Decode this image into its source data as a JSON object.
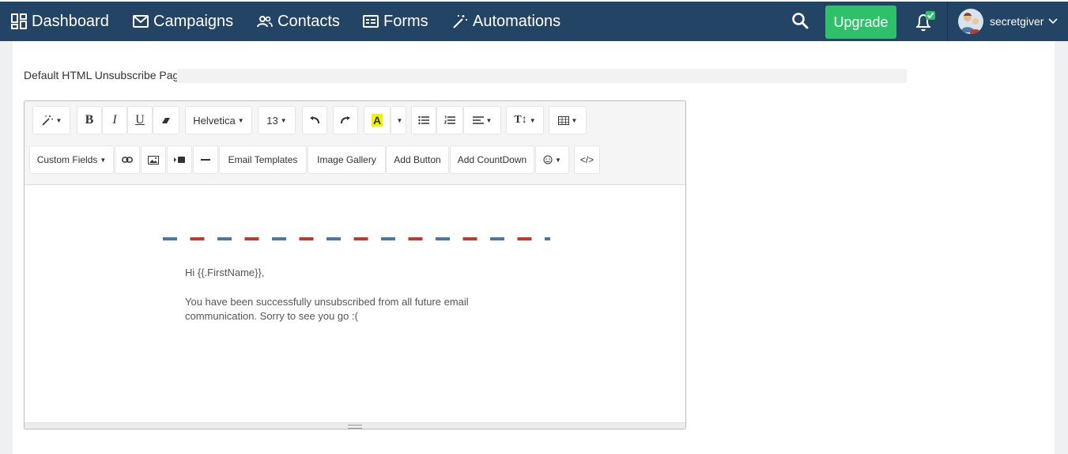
{
  "nav": {
    "items": [
      {
        "label": "Dashboard",
        "icon": "dashboard-icon"
      },
      {
        "label": "Campaigns",
        "icon": "envelope-icon"
      },
      {
        "label": "Contacts",
        "icon": "users-icon"
      },
      {
        "label": "Forms",
        "icon": "form-icon"
      },
      {
        "label": "Automations",
        "icon": "magic-wand-icon"
      }
    ],
    "upgrade_label": "Upgrade",
    "username": "secretgiver",
    "colors": {
      "navbar": "#244465",
      "upgrade": "#2ec16a",
      "notification_badge": "#2ec16a"
    }
  },
  "form": {
    "page_label": "Default HTML Unsubscribe Page",
    "page_value": ""
  },
  "toolbar": {
    "font_family": "Helvetica",
    "font_size": "13",
    "custom_fields": "Custom Fields",
    "email_templates": "Email Templates",
    "image_gallery": "Image Gallery",
    "add_button": "Add Button",
    "add_countdown": "Add CountDown",
    "code_view": "</>",
    "bold": "B",
    "italic": "I",
    "underline": "U",
    "text_height": "T↕"
  },
  "email_body": {
    "greeting": "Hi {{.FirstName}},",
    "message": "You have been successfully unsubscribed from all future email communication. Sorry to see you go :(",
    "border_colors": [
      "#4a76a8",
      "#c0392b"
    ]
  }
}
